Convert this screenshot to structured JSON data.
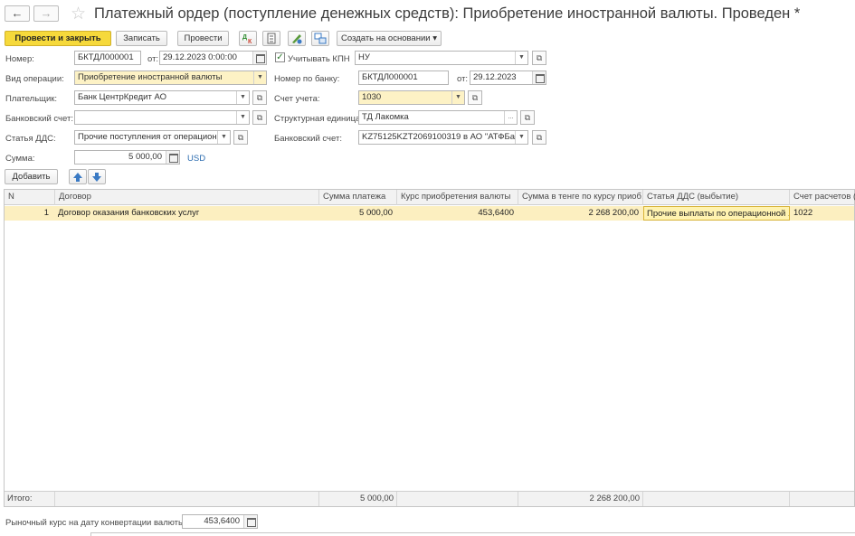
{
  "window": {
    "title": "Платежный ордер (поступление денежных средств): Приобретение иностранной валюты. Проведен *"
  },
  "nav": {
    "back_icon": "arrow-left-icon",
    "forward_icon": "arrow-right-icon",
    "back": "←",
    "forward": "→",
    "star": "☆"
  },
  "toolbar": {
    "post_close": "Провести и закрыть",
    "save": "Записать",
    "post": "Провести",
    "create_based_on": "Создать на основании ▾"
  },
  "form": {
    "number_label": "Номер:",
    "number_value": "БКТДЛ000001",
    "from_label": "от:",
    "date_value": "29.12.2023  0:00:00",
    "kpn_label": "Учитывать КПН",
    "kpn_checked": "✓",
    "kpn_value": "НУ",
    "operation_label": "Вид операции:",
    "operation_value": "Приобретение иностранной валюты",
    "bank_number_label": "Номер по банку:",
    "bank_number_value": "БКТДЛ000001",
    "bank_from_label": "от:",
    "bank_date_value": "29.12.2023",
    "payer_label": "Плательщик:",
    "payer_value": "Банк ЦентрКредит АО",
    "account_label": "Счет учета:",
    "account_value": "1030",
    "bank_account_label": "Банковский счет:",
    "bank_account_value": "",
    "struct_unit_label": "Структурная единица:",
    "struct_unit_value": "ТД Лакомка",
    "dds_label": "Статья ДДС:",
    "dds_value": "Прочие поступления от операционн",
    "bank_account2_label": "Банковский счет:",
    "bank_account2_value": "KZ75125KZT2069100319 в АО \"АТФБан",
    "sum_label": "Сумма:",
    "sum_value": "5 000,00",
    "currency": "USD"
  },
  "table_toolbar": {
    "add": "Добавить"
  },
  "table": {
    "columns": [
      "N",
      "Договор",
      "Сумма платежа",
      "Курс приобретения валюты",
      "Сумма в тенге по курсу приоб...",
      "Статья ДДС (выбытие)",
      "Счет расчетов (Б"
    ],
    "rows": [
      [
        "1",
        "Договор оказания банковских услуг",
        "5 000,00",
        "453,6400",
        "2 268 200,00",
        "Прочие выплаты по операционной ...",
        "1022"
      ]
    ],
    "footer": {
      "label": "Итого:",
      "sum": "5 000,00",
      "sum_tenge": "2 268 200,00"
    }
  },
  "bottom": {
    "rate_label": "Рыночный курс на дату конвертации валюты:",
    "rate_value": "453,6400"
  }
}
